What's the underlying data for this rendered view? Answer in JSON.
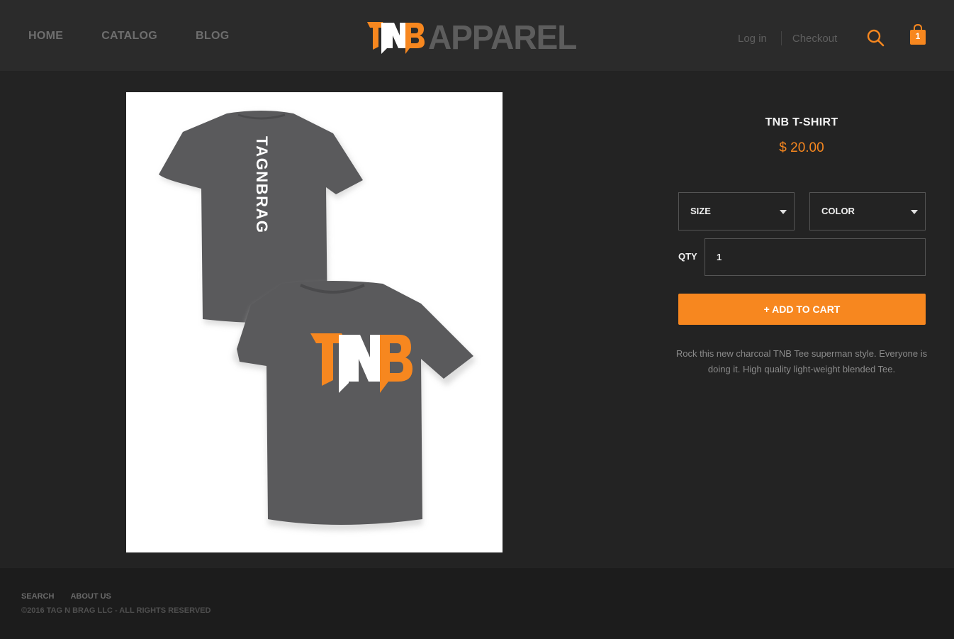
{
  "nav": {
    "items": [
      "HOME",
      "CATALOG",
      "BLOG"
    ]
  },
  "logo": {
    "mark": "TNB",
    "wordmark": "APPAREL"
  },
  "account": {
    "login": "Log in",
    "checkout": "Checkout"
  },
  "cart": {
    "count": "1"
  },
  "product": {
    "image_print_back": "TAGNBRAG",
    "image_print_front": "TNB",
    "title": "TNB T-SHIRT",
    "price": "$ 20.00",
    "size_label": "SIZE",
    "color_label": "COLOR",
    "qty_label": "QTY",
    "qty_value": "1",
    "add_to_cart": "+ ADD TO CART",
    "description": "Rock this new charcoal TNB Tee superman style.  Everyone is doing it.  High quality light-weight blended Tee."
  },
  "footer": {
    "links": [
      "SEARCH",
      "ABOUT US"
    ],
    "copyright": "©2016 TAG N BRAG LLC - ALL RIGHTS RESERVED"
  },
  "colors": {
    "accent": "#f7871f",
    "header_bg": "#2b2b2b",
    "page_bg": "#232323",
    "footer_bg": "#1c1c1c",
    "shirt": "#5a5a5c"
  }
}
